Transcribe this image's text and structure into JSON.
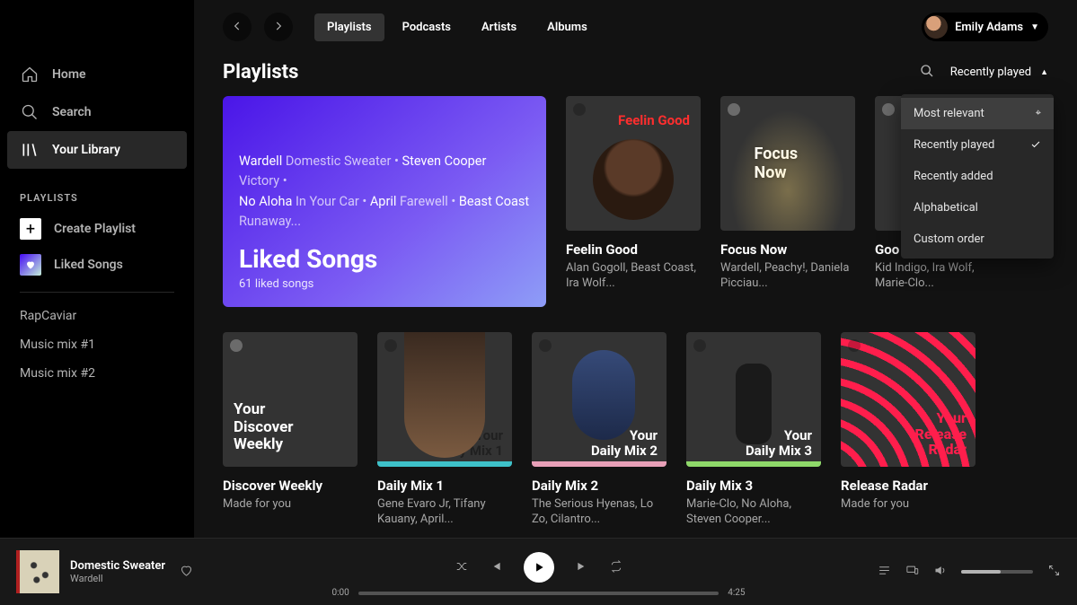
{
  "sidebar": {
    "nav": [
      {
        "label": "Home"
      },
      {
        "label": "Search"
      },
      {
        "label": "Your Library"
      }
    ],
    "section_label": "PLAYLISTS",
    "create_label": "Create Playlist",
    "liked_label": "Liked Songs",
    "playlists": [
      {
        "label": "RapCaviar"
      },
      {
        "label": "Music mix #1"
      },
      {
        "label": "Music mix #2"
      }
    ]
  },
  "topbar": {
    "tabs": [
      {
        "label": "Playlists"
      },
      {
        "label": "Podcasts"
      },
      {
        "label": "Artists"
      },
      {
        "label": "Albums"
      }
    ],
    "user_name": "Emily Adams"
  },
  "page": {
    "title": "Playlists",
    "sort_label": "Recently played",
    "sort_options": [
      {
        "label": "Most relevant",
        "hover": true,
        "checked": false
      },
      {
        "label": "Recently played",
        "hover": false,
        "checked": true
      },
      {
        "label": "Recently added",
        "hover": false,
        "checked": false
      },
      {
        "label": "Alphabetical",
        "hover": false,
        "checked": false
      },
      {
        "label": "Custom order",
        "hover": false,
        "checked": false
      }
    ]
  },
  "hero": {
    "line_a1": "Wardell ",
    "line_a2": "Domestic Sweater • ",
    "line_a3": "Steven Cooper ",
    "line_a4": "Victory • ",
    "line_b1": "No Aloha ",
    "line_b2": "In Your Car • ",
    "line_b3": "April ",
    "line_b4": "Farewell • ",
    "line_b5": "Beast Coast ",
    "line_c1": "Runaway...",
    "title": "Liked Songs",
    "subtitle": "61 liked songs"
  },
  "row1": [
    {
      "title": "Feelin Good",
      "subtitle": "Alan Gogoll, Beast Coast, Ira Wolf...",
      "art_label": "Feelin Good"
    },
    {
      "title": "Focus Now",
      "subtitle": "Wardell, Peachy!, Daniela Picciau...",
      "art_label": "Focus Now"
    },
    {
      "title": "Goo",
      "subtitle": "Kid Indigo, Ira Wolf, Marie-Clo...",
      "art_label": ""
    }
  ],
  "row2": [
    {
      "title": "Discover Weekly",
      "subtitle": "Made for you",
      "art_label": "Your\nDiscover\nWeekly"
    },
    {
      "title": "Daily Mix 1",
      "subtitle": "Gene Evaro Jr, Tifany Kauany, April...",
      "art_label": "Your\nDaily Mix 1"
    },
    {
      "title": "Daily Mix 2",
      "subtitle": "The Serious Hyenas, Lo Zo, Cilantro...",
      "art_label": "Your\nDaily Mix 2"
    },
    {
      "title": "Daily Mix 3",
      "subtitle": "Marie-Clo, No Aloha, Steven Cooper...",
      "art_label": "Your\nDaily Mix 3"
    },
    {
      "title": "Release Radar",
      "subtitle": "Made for you",
      "art_label": "Your\nRelease\nRadar"
    }
  ],
  "player": {
    "track": "Domestic Sweater",
    "artist": "Wardell",
    "elapsed": "0:00",
    "duration": "4:25"
  },
  "colors": {
    "accent_purple": "#5b21e8",
    "release_red": "#ff1e4c",
    "dm1_stripe": "#3ec1c9",
    "dm2_stripe": "#e8a0b8",
    "dm3_stripe": "#8fd96a"
  }
}
